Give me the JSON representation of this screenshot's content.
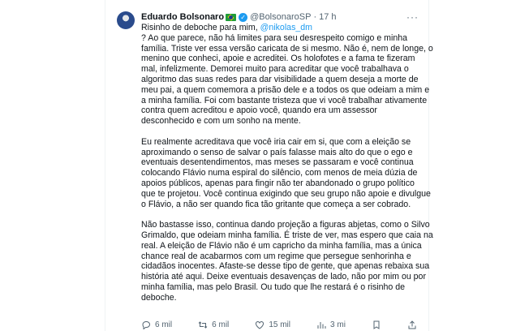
{
  "author": {
    "name": "Eduardo Bolsonaro",
    "handle": "@BolsonaroSP",
    "separator": "·",
    "time": "17 h"
  },
  "tweet": {
    "first_line_text": "Risinho de deboche para mim, ",
    "mention": "@nikolas_dm",
    "lines": [
      "? Ao que parece, não há limites para seu desrespeito comigo e minha",
      "família. Triste ver essa versão caricata de si mesmo. Não é, nem de longe, o",
      "menino que conheci, apoie e acreditei. Os holofotes e a fama te fizeram",
      "mal, infelizmente. Demorei muito para acreditar que você trabalhava o",
      "algoritmo das suas redes para dar visibilidade a quem deseja a morte de",
      "meu pai, a quem comemora a prisão dele e a todos os que odeiam a mim e",
      "a minha família. Foi com bastante tristeza que vi você trabalhar ativamente",
      "contra quem acreditou e apoio você, quando era um assessor",
      "desconhecido e com um sonho na mente.",
      "",
      "Eu realmente acreditava que você iria cair em si, que com a eleição se",
      "aproximando o senso de salvar o país falasse mais alto do que o ego e",
      "eventuais desentendimentos, mas meses se passaram e você continua",
      "colocando Flávio numa espiral do silêncio, com menos de meia dúzia de",
      "apoios públicos, apenas para fingir não ter abandonado o grupo político",
      "que te projetou. Você continua exigindo que seu grupo não apoie e divulgue",
      "o Flávio, a não ser quando fica tão gritante que começa a ser cobrado.",
      "",
      "Não bastasse isso, continua dando projeção a figuras abjetas, como o Silvo",
      "Grimaldo, que odeiam minha família. É triste de ver, mas espero que caia na",
      "real. A eleição de Flávio não é um capricho da minha família, mas a única",
      "chance real de acabarmos com um regime que persegue senhorinha e",
      "cidadãos inocentes. Afaste-se desse tipo de gente, que apenas rebaixa sua",
      "história até aqui. Deixe eventuais desavenças de lado, não por mim ou por",
      "minha família, mas pelo Brasil. Ou tudo que lhe restará é o risinho de",
      "deboche."
    ]
  },
  "actions": {
    "replies": "6 mil",
    "reposts": "6 mil",
    "likes": "15 mil",
    "views": "3 mi"
  },
  "icons": [
    "avatar",
    "brazil-flag-icon",
    "verified-badge-icon",
    "more-icon",
    "reply-icon",
    "repost-icon",
    "like-icon",
    "views-icon",
    "bookmark-icon",
    "share-icon"
  ],
  "colors": {
    "link": "#1d9bf0",
    "secondary": "#536471",
    "text": "#0f1419"
  }
}
